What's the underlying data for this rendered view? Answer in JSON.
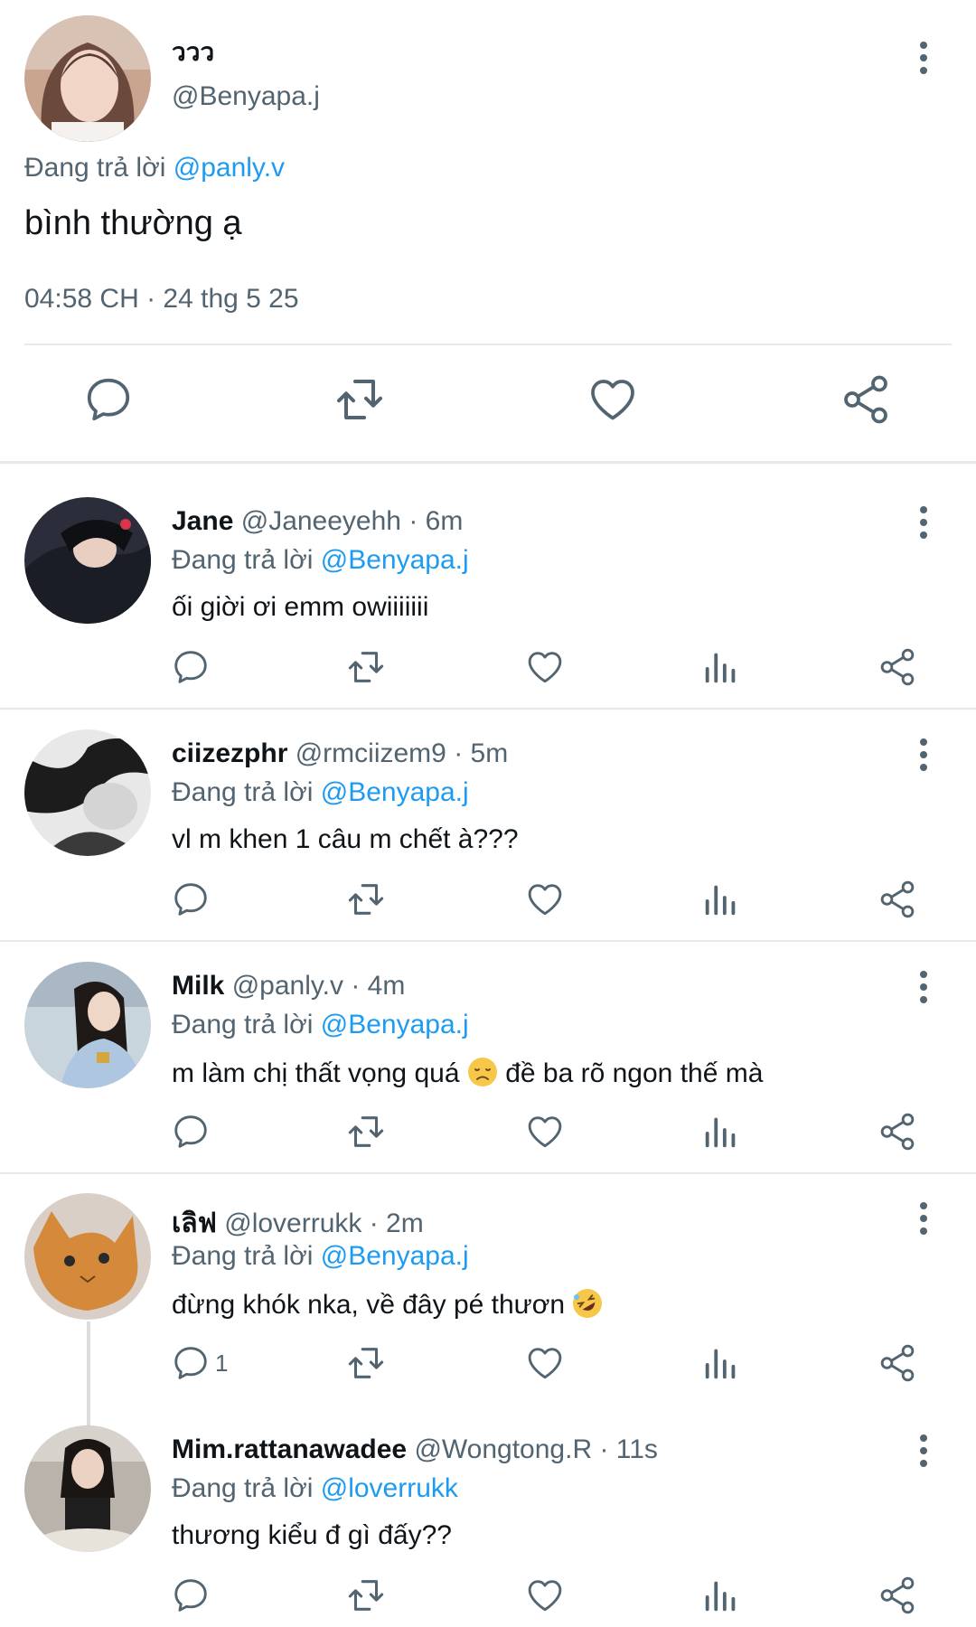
{
  "main_tweet": {
    "author_name": "ววว",
    "handle": "@Benyapa.j",
    "replying_prefix": "Đang trả lời",
    "replying_to": "@panly.v",
    "text": "bình thường ạ",
    "timestamp": "04:58 CH · 24 thg 5 25"
  },
  "replies": [
    {
      "name": "Jane",
      "handle": "@Janeeyehh",
      "time": "· 6m",
      "replying_prefix": "Đang trả lời",
      "replying_to": "@Benyapa.j",
      "text": "ối giời ơi emm owiiiiiii",
      "reply_count": ""
    },
    {
      "name": "ciizezphr",
      "handle": "@rmciizem9",
      "time": "· 5m",
      "replying_prefix": "Đang trả lời",
      "replying_to": "@Benyapa.j",
      "text": "vl m khen 1 câu m chết à???",
      "reply_count": ""
    },
    {
      "name": "Milk",
      "handle": "@panly.v",
      "time": "· 4m",
      "replying_prefix": "Đang trả lời",
      "replying_to": "@Benyapa.j",
      "text_before_emoji": "m làm chị thất vọng quá",
      "text_after_emoji": "đề ba rõ ngon thế mà",
      "emoji": "disappointed-face-emoji",
      "reply_count": ""
    },
    {
      "name": "เลิฟ",
      "handle": "@loverrukk",
      "time": "· 2m",
      "replying_prefix": "Đang trả lời",
      "replying_to": "@Benyapa.j",
      "text_before_emoji": "đừng khók nka, về đây pé thươn",
      "emoji": "rolling-laughing-emoji",
      "reply_count": "1"
    },
    {
      "name": "Mim.rattanawadee",
      "handle": "@Wongtong.R",
      "time": "· 11s",
      "replying_prefix": "Đang trả lời",
      "replying_to": "@loverrukk",
      "text": "thương kiểu đ gì đấy??",
      "reply_count": ""
    }
  ],
  "colors": {
    "link": "#1d9bf0",
    "secondary_text": "#536471",
    "separator": "#e6e9eb",
    "icon": "#536471"
  },
  "icons": [
    "reply-icon",
    "retweet-icon",
    "like-icon",
    "views-icon",
    "share-icon",
    "more-icon"
  ]
}
